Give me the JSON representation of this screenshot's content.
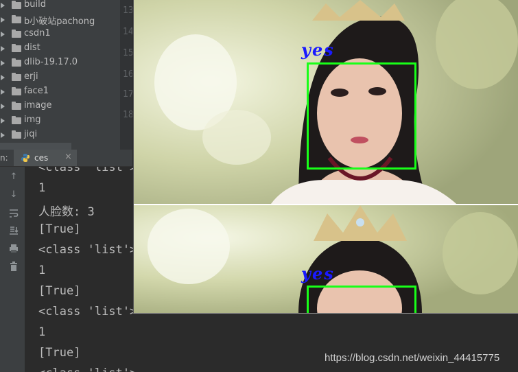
{
  "project_tree": {
    "items": [
      {
        "label": "build"
      },
      {
        "label": "b小破站pachong"
      },
      {
        "label": "csdn1"
      },
      {
        "label": "dist"
      },
      {
        "label": "dlib-19.17.0"
      },
      {
        "label": "erji"
      },
      {
        "label": "face1"
      },
      {
        "label": "image"
      },
      {
        "label": "img"
      },
      {
        "label": "jiqi"
      }
    ],
    "line_numbers": [
      "13",
      "14",
      "15",
      "16",
      "17",
      "18"
    ]
  },
  "run_panel": {
    "label": "n:",
    "tab": {
      "label": "ces",
      "close": "×"
    }
  },
  "console": {
    "lines": [
      "<class 'list'>",
      "1",
      "人脸数: 3",
      "[True]",
      "<class 'list'>",
      "1",
      "[True]",
      "<class 'list'>",
      "1",
      "[True]",
      "<class 'list'>"
    ]
  },
  "image_window": {
    "detections": [
      {
        "label": "yes"
      },
      {
        "label": "yes"
      }
    ],
    "box_color": "#18ff18",
    "label_color": "#1a1aff"
  },
  "watermark": "https://blog.csdn.net/weixin_44415775"
}
